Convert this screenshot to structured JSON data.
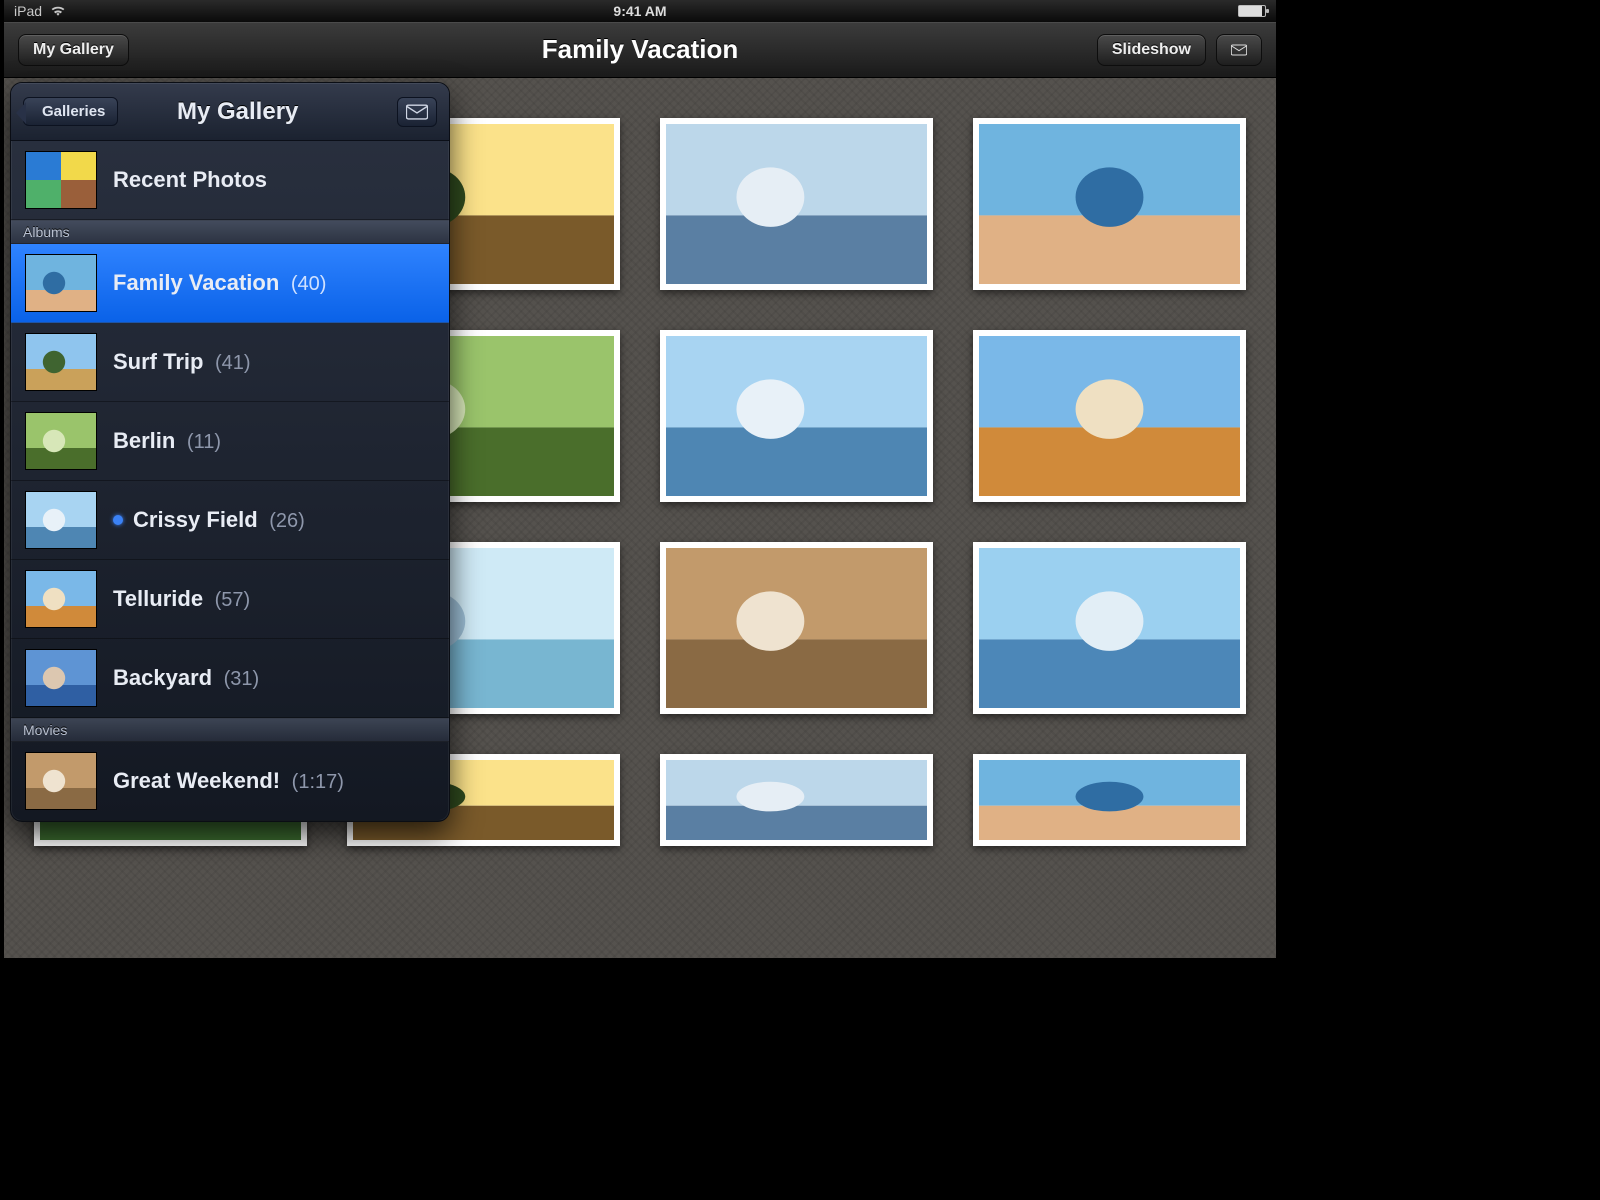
{
  "status": {
    "device": "iPad",
    "time": "9:41 AM"
  },
  "nav": {
    "back_label": "My Gallery",
    "title": "Family Vacation",
    "slideshow_label": "Slideshow"
  },
  "popover": {
    "back_label": "Galleries",
    "title": "My Gallery",
    "recent_label": "Recent Photos",
    "sections": {
      "albums_header": "Albums",
      "movies_header": "Movies"
    },
    "albums": [
      {
        "label": "Family Vacation",
        "count": "(40)",
        "selected": true,
        "dot": false
      },
      {
        "label": "Surf Trip",
        "count": "(41)",
        "selected": false,
        "dot": false
      },
      {
        "label": "Berlin",
        "count": "(11)",
        "selected": false,
        "dot": false
      },
      {
        "label": "Crissy Field",
        "count": "(26)",
        "selected": false,
        "dot": true
      },
      {
        "label": "Telluride",
        "count": "(57)",
        "selected": false,
        "dot": false
      },
      {
        "label": "Backyard",
        "count": "(31)",
        "selected": false,
        "dot": false
      }
    ],
    "movies": [
      {
        "label": "Great Weekend!",
        "count": "(1:17)",
        "selected": false
      }
    ]
  },
  "grid": {
    "rows": 4,
    "cols": 4
  }
}
